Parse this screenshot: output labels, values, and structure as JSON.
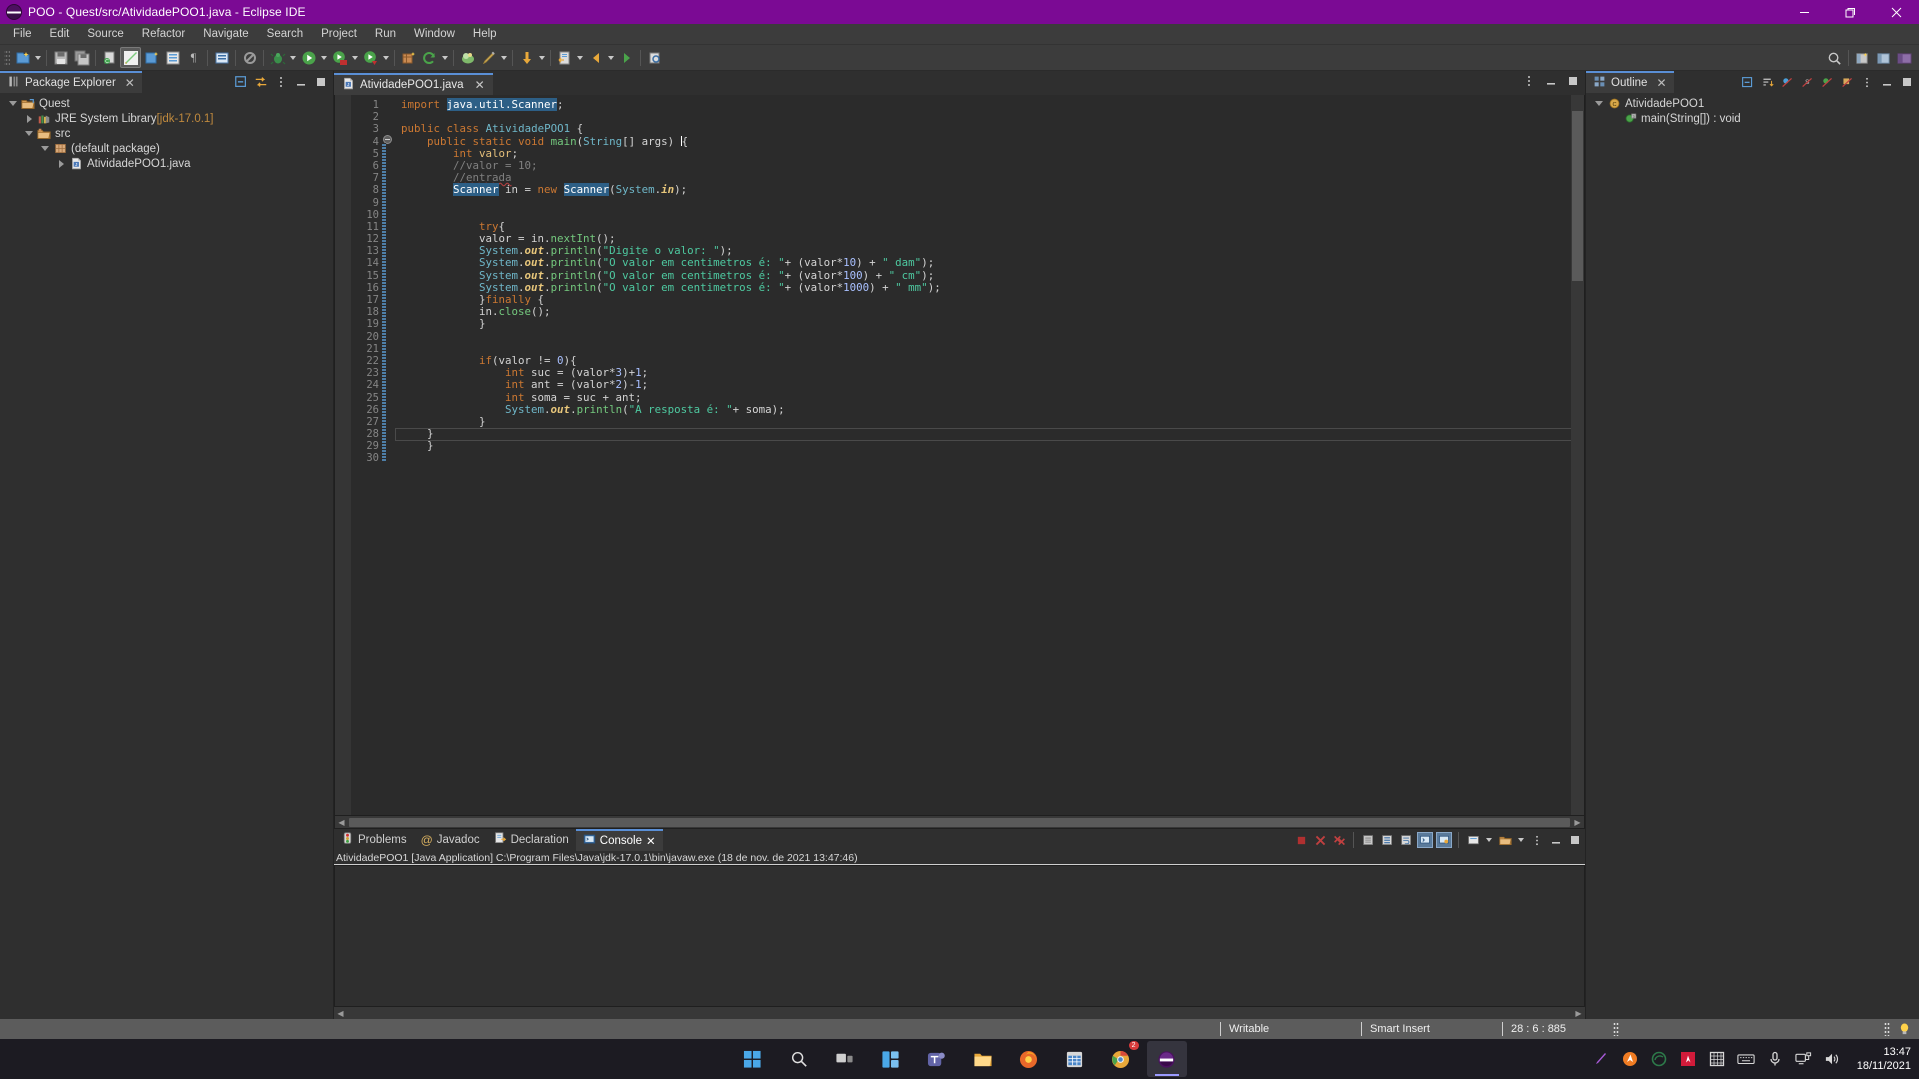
{
  "window": {
    "title": "POO - Quest/src/AtividadePOO1.java - Eclipse IDE",
    "minimize_label": "Minimize",
    "maximize_label": "Restore",
    "close_label": "Close"
  },
  "menubar": {
    "items": [
      "File",
      "Edit",
      "Source",
      "Refactor",
      "Navigate",
      "Search",
      "Project",
      "Run",
      "Window",
      "Help"
    ]
  },
  "toolbar": {
    "icons": [
      "new-wizard-icon",
      "save-icon",
      "save-all-icon",
      "link-with-editor-icon",
      "open-task-icon",
      "new-java-package-icon",
      "open-type-icon",
      "pilcrow-icon",
      "toggle-mark-occurrences-icon",
      "skip-breakpoints-icon",
      "debug-icon",
      "run-icon",
      "run-coverage-icon",
      "run-external-tools-icon",
      "new-java-project-icon",
      "refresh-icon",
      "open-perspective-icon",
      "annotations-icon",
      "next-annotation-icon",
      "previous-edit-icon",
      "back-icon",
      "forward-icon",
      "search-icon"
    ],
    "right_icons": [
      "quick-access-search-icon",
      "open-perspective-icon",
      "java-perspective-icon",
      "java-ee-perspective-icon"
    ]
  },
  "package_explorer": {
    "tab_label": "Package Explorer",
    "close_label": "✕",
    "tools": [
      "collapse-all-icon",
      "link-with-editor-icon",
      "view-menu-icon",
      "minimize-icon",
      "maximize-icon"
    ],
    "tree": [
      {
        "label": "Quest",
        "suffix": "",
        "depth": 0,
        "expanded": true,
        "icon": "java-project-icon",
        "has_children": true
      },
      {
        "label": "JRE System Library ",
        "suffix": "[jdk-17.0.1]",
        "depth": 1,
        "expanded": false,
        "icon": "library-icon",
        "has_children": true
      },
      {
        "label": "src",
        "suffix": "",
        "depth": 1,
        "expanded": true,
        "icon": "source-folder-icon",
        "has_children": true
      },
      {
        "label": "(default package)",
        "suffix": "",
        "depth": 2,
        "expanded": true,
        "icon": "package-icon",
        "has_children": true
      },
      {
        "label": "AtividadePOO1.java",
        "suffix": "",
        "depth": 3,
        "expanded": false,
        "icon": "java-file-icon",
        "has_children": true
      }
    ]
  },
  "editor": {
    "tab_label": "AtividadePOO1.java",
    "tab_icon": "java-file-icon",
    "close_label": "✕",
    "tools": [
      "minimize-icon",
      "maximize-icon",
      "view-menu-icon"
    ],
    "lines": [
      {
        "n": 1,
        "html": "<span class=\"kw2\">import</span> <span class=\"sel\">java.util.Scanner</span>;"
      },
      {
        "n": 2,
        "html": ""
      },
      {
        "n": 3,
        "html": "<span class=\"kw2\">public</span> <span class=\"kw2\">class</span> <span class=\"typ\">AtividadePOO1</span> {"
      },
      {
        "n": 4,
        "html": "    <span class=\"kw2\">public</span> <span class=\"kw2\">static</span> <span class=\"kw2\">void</span> <span class=\"mth\">main</span>(<span class=\"typ\">String</span>[] args) <span class=\"caret\"></span>{"
      },
      {
        "n": 5,
        "html": "        <span class=\"kw2\">int</span> <span class=\"var\">valor</span>;"
      },
      {
        "n": 6,
        "html": "        <span class=\"cmt\">//valor = 10;</span>"
      },
      {
        "n": 7,
        "html": "        <span class=\"cmt squig\">//entrada</span>"
      },
      {
        "n": 8,
        "html": "        <span class=\"sel\">Scanner</span> in = <span class=\"kw2\">new</span> <span class=\"sel\">Scanner</span>(<span class=\"typ\">System</span>.<span class=\"fld\">in</span>);"
      },
      {
        "n": 9,
        "html": ""
      },
      {
        "n": 10,
        "html": ""
      },
      {
        "n": 11,
        "html": "            <span class=\"kw2\">try</span>{"
      },
      {
        "n": 12,
        "html": "            valor = in.<span class=\"mth\">nextInt</span>();"
      },
      {
        "n": 13,
        "html": "            <span class=\"typ\">System</span>.<span class=\"fld\">out</span>.<span class=\"mth\">println</span>(<span class=\"str\">\"Digite o valor: \"</span>);"
      },
      {
        "n": 14,
        "html": "            <span class=\"typ\">System</span>.<span class=\"fld\">out</span>.<span class=\"mth\">println</span>(<span class=\"str\">\"O valor em centimetros é: \"</span>+ (valor*<span class=\"num\">10</span>) + <span class=\"str\">\" dam\"</span>);"
      },
      {
        "n": 15,
        "html": "            <span class=\"typ\">System</span>.<span class=\"fld\">out</span>.<span class=\"mth\">println</span>(<span class=\"str\">\"O valor em centimetros é: \"</span>+ (valor*<span class=\"num\">100</span>) + <span class=\"str\">\" cm\"</span>);"
      },
      {
        "n": 16,
        "html": "            <span class=\"typ\">System</span>.<span class=\"fld\">out</span>.<span class=\"mth\">println</span>(<span class=\"str\">\"O valor em centimetros é: \"</span>+ (valor*<span class=\"num\">1000</span>) + <span class=\"str\">\" mm\"</span>);"
      },
      {
        "n": 17,
        "html": "            }<span class=\"kw2\">finally</span> {"
      },
      {
        "n": 18,
        "html": "            in.<span class=\"mth\">close</span>();"
      },
      {
        "n": 19,
        "html": "            }"
      },
      {
        "n": 20,
        "html": ""
      },
      {
        "n": 21,
        "html": ""
      },
      {
        "n": 22,
        "html": "            <span class=\"kw2\">if</span>(valor != <span class=\"num\">0</span>){"
      },
      {
        "n": 23,
        "html": "                <span class=\"kw2\">int</span> suc = (valor*<span class=\"num\">3</span>)+<span class=\"num\">1</span>;"
      },
      {
        "n": 24,
        "html": "                <span class=\"kw2\">int</span> ant = (valor*<span class=\"num\">2</span>)-<span class=\"num\">1</span>;"
      },
      {
        "n": 25,
        "html": "                <span class=\"kw2\">int</span> soma = suc + ant;"
      },
      {
        "n": 26,
        "html": "                <span class=\"typ\">System</span>.<span class=\"fld\">out</span>.<span class=\"mth\">println</span>(<span class=\"str\">\"A resposta é: \"</span>+ soma);"
      },
      {
        "n": 27,
        "html": "            }"
      },
      {
        "n": 28,
        "html": "    }"
      },
      {
        "n": 29,
        "html": "    }"
      },
      {
        "n": 30,
        "html": ""
      }
    ]
  },
  "bottom_panel": {
    "tabs": [
      {
        "label": "Problems",
        "icon": "problems-icon",
        "active": false
      },
      {
        "label": "Javadoc",
        "icon": "javadoc-icon",
        "active": false
      },
      {
        "label": "Declaration",
        "icon": "declaration-icon",
        "active": false
      },
      {
        "label": "Console",
        "icon": "console-icon",
        "active": true
      }
    ],
    "close_label": "✕",
    "console_header": "AtividadePOO1 [Java Application] C:\\Program Files\\Java\\jdk-17.0.1\\bin\\javaw.exe  (18 de nov. de 2021 13:47:46)",
    "console_output": "",
    "tools": [
      "terminate-icon",
      "remove-launch-icon",
      "remove-all-terminated-icon",
      "clear-console-icon",
      "scroll-lock-icon",
      "word-wrap-icon",
      "show-console-on-output-icon",
      "pin-console-icon",
      "display-selected-console-icon",
      "open-console-icon",
      "view-menu-icon",
      "minimize-icon",
      "maximize-icon"
    ]
  },
  "outline": {
    "tab_label": "Outline",
    "close_label": "✕",
    "tools": [
      "collapse-all-icon",
      "sort-icon",
      "hide-fields-icon",
      "hide-static-icon",
      "hide-non-public-icon",
      "hide-local-types-icon",
      "view-menu-icon",
      "minimize-icon",
      "maximize-icon"
    ],
    "tree": [
      {
        "label": "AtividadePOO1",
        "depth": 0,
        "expanded": true,
        "icon": "java-class-icon",
        "has_children": true
      },
      {
        "label": "main(String[]) : void",
        "depth": 1,
        "expanded": false,
        "icon": "public-method-static-icon",
        "has_children": false
      }
    ]
  },
  "statusbar": {
    "writable": "Writable",
    "insert_mode": "Smart Insert",
    "position": "28 : 6 : 885"
  },
  "taskbar": {
    "items": [
      "start-windows-icon",
      "search-icon",
      "task-view-icon",
      "widgets-icon",
      "teams-icon",
      "file-explorer-icon",
      "firefox-icon",
      "excel-icon",
      "chrome-icon",
      "eclipse-icon"
    ],
    "tray": [
      "pen-icon",
      "avast-icon",
      "shield-icon",
      "adobe-icon",
      "grid-icon",
      "keyboard-icon",
      "microphone-icon",
      "network-icon",
      "volume-icon"
    ],
    "clock_time": "13:47",
    "clock_date": "18/11/2021"
  },
  "colors": {
    "title_bar": "#7b0a94",
    "chrome": "#3c3c3c",
    "editor_bg": "#2b2b2b",
    "panel_bg": "#2f2f2f",
    "accent_tab": "#5a8fd6",
    "status_bg": "#5c5c5c",
    "selection": "#2d5f86",
    "string_green": "#4ec9a0",
    "keyword_orange": "#cc7832",
    "type_teal": "#6fb7c9"
  }
}
